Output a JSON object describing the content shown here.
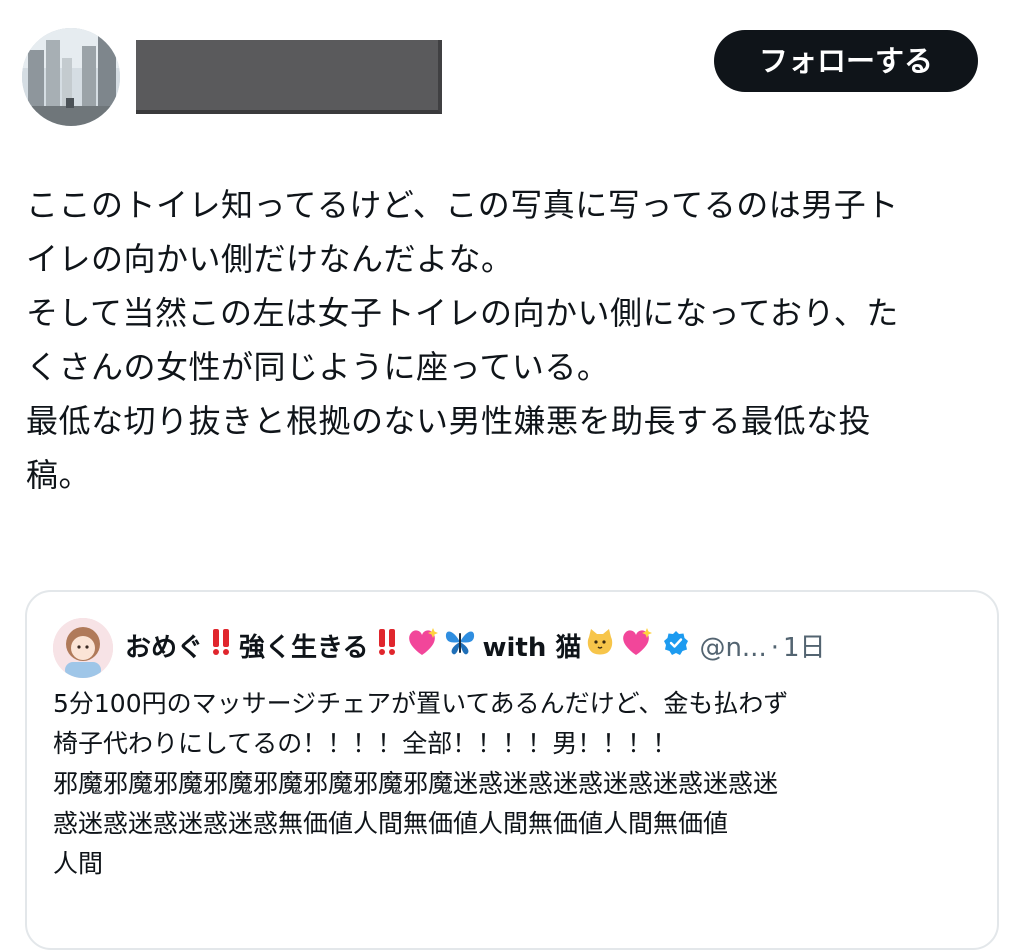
{
  "header": {
    "follow_label": "フォローする"
  },
  "post": {
    "text": "ここのトイレ知ってるけど、この写真に写ってるのは男子ト\nイレの向かい側だけなんだよな。\nそして当然この左は女子トイレの向かい側になっており、た\nくさんの女性が同じように座っている。\n最低な切り抜きと根拠のない男性嫌悪を助長する最低な投\n稿。"
  },
  "quote": {
    "name_part1": "おめぐ",
    "name_part2": "強く生きる",
    "name_part3": "with 猫",
    "handle": "@n...",
    "separator": "·",
    "time": "1日",
    "body": "5分100円のマッサージチェアが置いてあるんだけど、金も払わず\n椅子代わりにしてるの！！！！全部！！！！男！！！！\n邪魔邪魔邪魔邪魔邪魔邪魔邪魔邪魔迷惑迷惑迷惑迷惑迷惑迷惑迷\n惑迷惑迷惑迷惑迷惑無価値人間無価値人間無価値人間無価値\n人間"
  },
  "colors": {
    "text": "#0f1419",
    "secondary": "#536471",
    "button_bg": "#0f1419",
    "button_text": "#ffffff",
    "verified": "#1d9bf0",
    "border": "#e3e7ea",
    "redaction": "#5a5a5c"
  },
  "icons": {
    "verified": "verified-badge-icon",
    "emoji_double_exclamation": "double-exclamation-emoji",
    "emoji_sparkling_heart": "sparkling-heart-emoji",
    "emoji_butterfly": "butterfly-emoji",
    "emoji_cat": "cat-face-emoji"
  }
}
